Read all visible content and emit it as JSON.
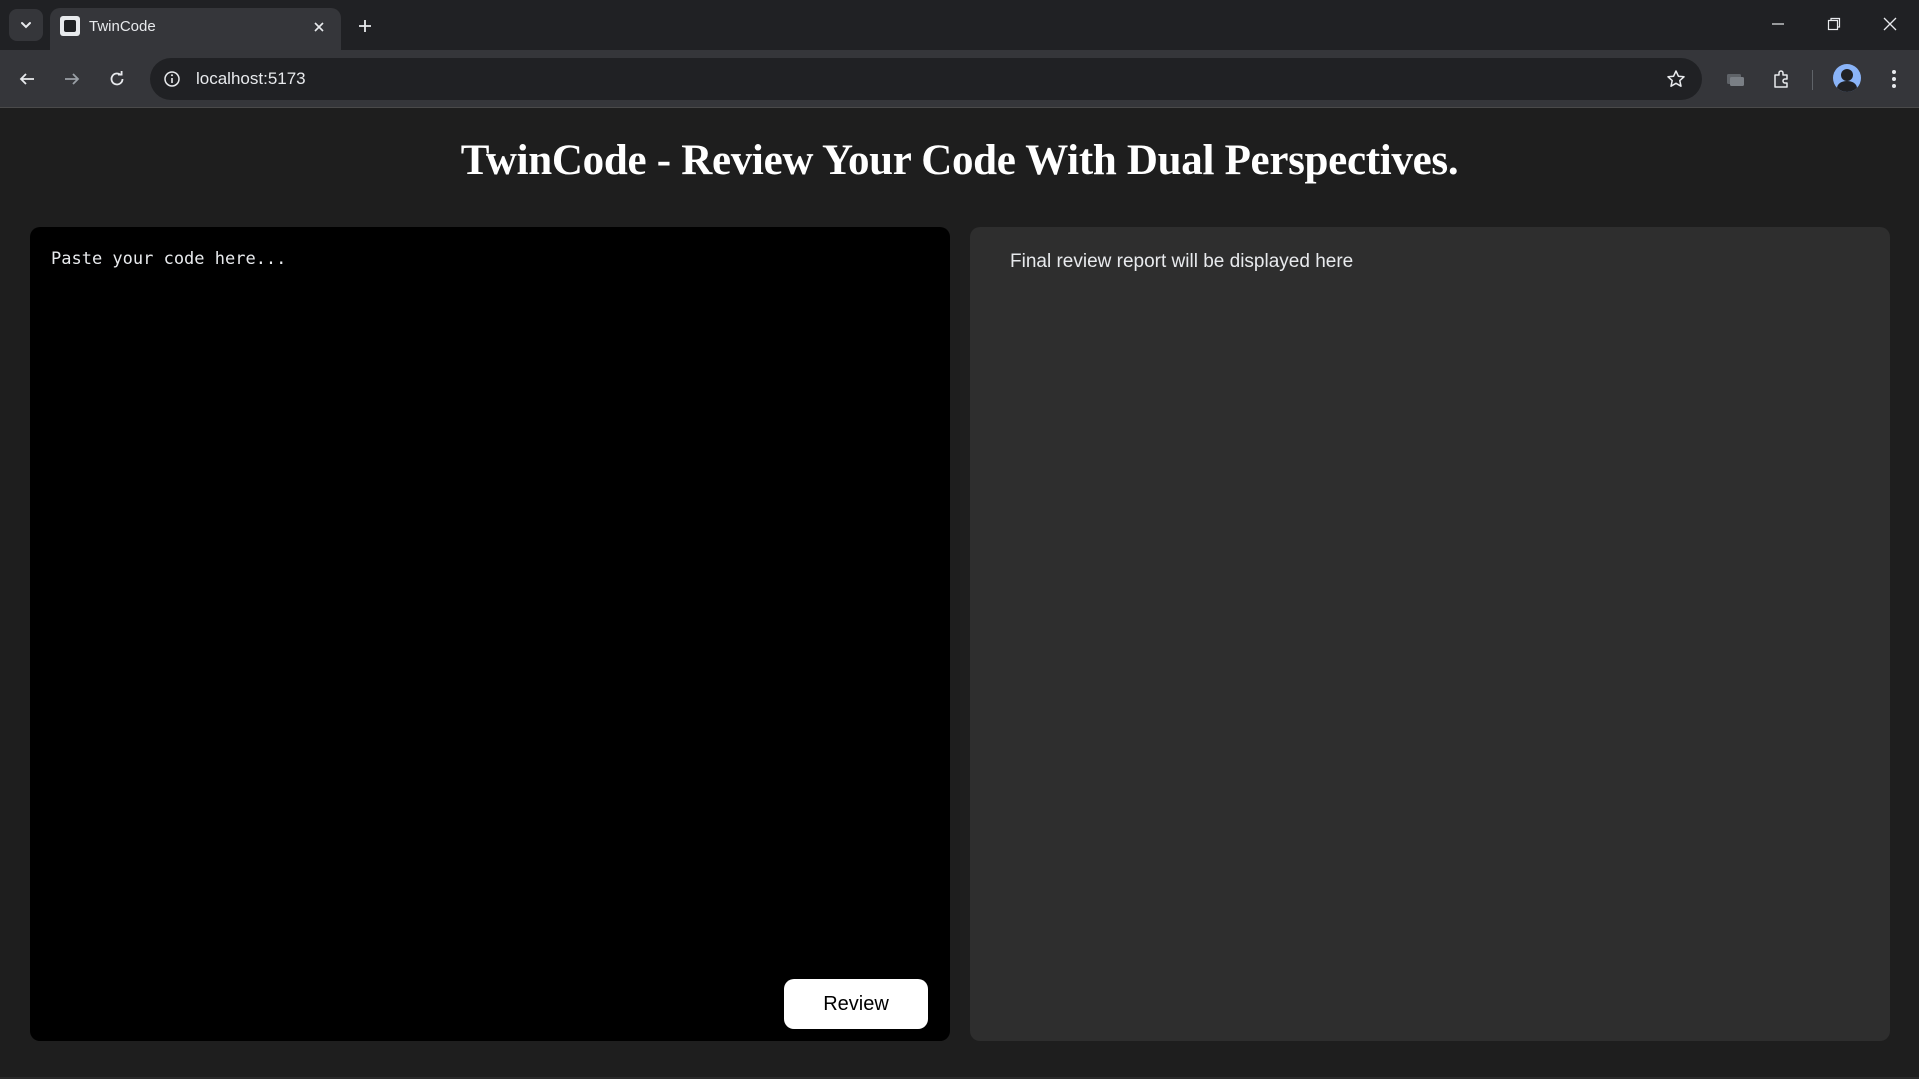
{
  "browser": {
    "tab_title": "TwinCode",
    "url": "localhost:5173"
  },
  "page": {
    "title": "TwinCode - Review Your Code With Dual Perspectives.",
    "editor_placeholder": "Paste your code here...",
    "review_button": "Review",
    "report_placeholder": "Final review report will be displayed here"
  },
  "colors": {
    "page_background": "#1e1e1e",
    "editor_background": "#000000",
    "report_background": "#2e2e2e",
    "button_background": "#ffffff"
  }
}
